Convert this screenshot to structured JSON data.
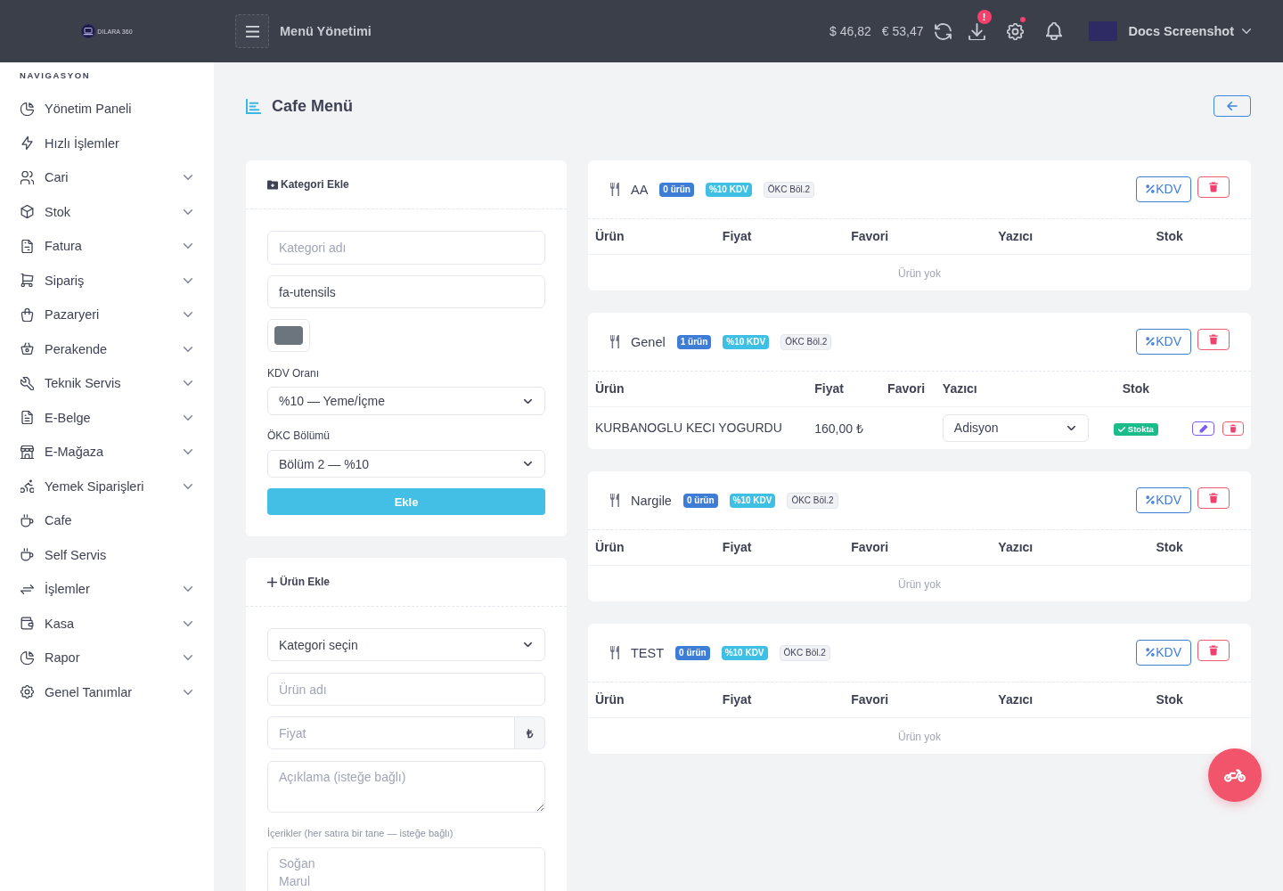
{
  "topbar": {
    "brand": "DILARA 360",
    "title": "Menü Yönetimi",
    "rates": [
      "$ 46,82",
      "€ 53,47"
    ],
    "download_badge": "!",
    "settings_alert": true,
    "user": "Docs Screenshot"
  },
  "sidebar": {
    "heading": "NAVIGASYON",
    "items": [
      {
        "label": "Yönetim Paneli",
        "expandable": false,
        "selected": false
      },
      {
        "label": "Hızlı İşlemler",
        "expandable": false,
        "selected": false
      },
      {
        "label": "Cari",
        "expandable": true,
        "selected": false
      },
      {
        "label": "Stok",
        "expandable": true,
        "selected": false
      },
      {
        "label": "Fatura",
        "expandable": true,
        "selected": false
      },
      {
        "label": "Sipariş",
        "expandable": true,
        "selected": false
      },
      {
        "label": "Pazaryeri",
        "expandable": true,
        "selected": false
      },
      {
        "label": "Perakende",
        "expandable": true,
        "selected": false
      },
      {
        "label": "Teknik Servis",
        "expandable": true,
        "selected": false
      },
      {
        "label": "E-Belge",
        "expandable": true,
        "selected": false
      },
      {
        "label": "E-Mağaza",
        "expandable": true,
        "selected": false
      },
      {
        "label": "Yemek Siparişleri",
        "expandable": true,
        "selected": false
      },
      {
        "label": "Cafe",
        "expandable": false,
        "selected": false
      },
      {
        "label": "Self Servis",
        "expandable": false,
        "selected": false
      },
      {
        "label": "İşlemler",
        "expandable": true,
        "selected": false
      },
      {
        "label": "Kasa",
        "expandable": true,
        "selected": false
      },
      {
        "label": "Rapor",
        "expandable": true,
        "selected": false
      },
      {
        "label": "Genel Tanımlar",
        "expandable": true,
        "selected": false
      }
    ]
  },
  "page": {
    "title": "Cafe Menü"
  },
  "category_form": {
    "title": "Kategori Ekle",
    "name_field": {
      "placeholder": "Kategori adı"
    },
    "icon_field": {
      "value": "fa-utensils"
    },
    "color_field": {
      "color": "#6c757d"
    },
    "vat_label": "KDV Oranı",
    "vat_select": {
      "value": "%10 — Yeme/İçme"
    },
    "section_label": "ÖKC Bölümü",
    "section_select": {
      "value": "Bölüm 2 — %10"
    },
    "submit": "Ekle"
  },
  "product_form": {
    "title": "Ürün Ekle",
    "category_select": {
      "value": "Kategori seçin"
    },
    "name_field": {
      "placeholder": "Ürün adı"
    },
    "price_field": {
      "placeholder": "Fiyat",
      "addon": "₺"
    },
    "description_field": {
      "placeholder": "Açıklama (isteğe bağlı)"
    },
    "ingredients_label": "İçerikler (her satıra bir tane — isteğe bağlı)",
    "ingredients_field": {
      "placeholder": "Soğan\nMarul"
    }
  },
  "categories": [
    {
      "name": "AA",
      "count": "0 ürün",
      "vat": "%10 KDV",
      "section": "ÖKC Böl.2",
      "vat_button": "KDV",
      "columns": [
        "Ürün",
        "Fiyat",
        "Favori",
        "Yazıcı",
        "Stok"
      ],
      "empty_text": "Ürün yok"
    },
    {
      "name": "Genel",
      "count": "1 ürün",
      "vat": "%10 KDV",
      "section": "ÖKC Böl.2",
      "vat_button": "KDV",
      "columns": [
        "Ürün",
        "Fiyat",
        "Favori",
        "Yazıcı",
        "Stok"
      ],
      "products": [
        {
          "name": "KURBANOGLU KECI YOGURDU",
          "price": "160,00 ₺",
          "printer": "Adisyon",
          "stock": "Stokta"
        }
      ]
    },
    {
      "name": "Nargile",
      "count": "0 ürün",
      "vat": "%10 KDV",
      "section": "ÖKC Böl.2",
      "vat_button": "KDV",
      "columns": [
        "Ürün",
        "Fiyat",
        "Favori",
        "Yazıcı",
        "Stok"
      ],
      "empty_text": "Ürün yok"
    },
    {
      "name": "TEST",
      "count": "0 ürün",
      "vat": "%10 KDV",
      "section": "ÖKC Böl.2",
      "vat_button": "KDV",
      "columns": [
        "Ürün",
        "Fiyat",
        "Favori",
        "Yazıcı",
        "Stok"
      ],
      "empty_text": "Ürün yok"
    }
  ]
}
